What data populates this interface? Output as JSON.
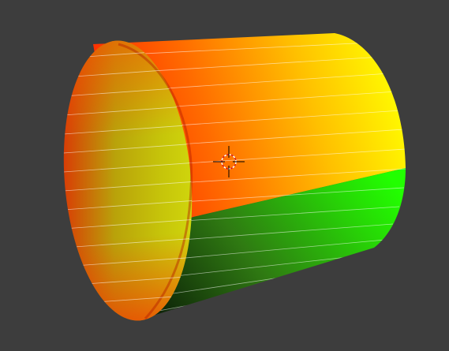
{
  "viewport": {
    "background": "#3d3d3d",
    "object": "cylinder-mesh",
    "shading": "vertex-colors",
    "colors": {
      "red": "#ff2a00",
      "orange": "#ff8c00",
      "yellow": "#ffff00",
      "green": "#22ff00",
      "dark_green": "#1b4d10",
      "olive": "#c8c000",
      "edge_lines": "#ffffff"
    },
    "cursor_icon": "3d-cursor-icon"
  }
}
